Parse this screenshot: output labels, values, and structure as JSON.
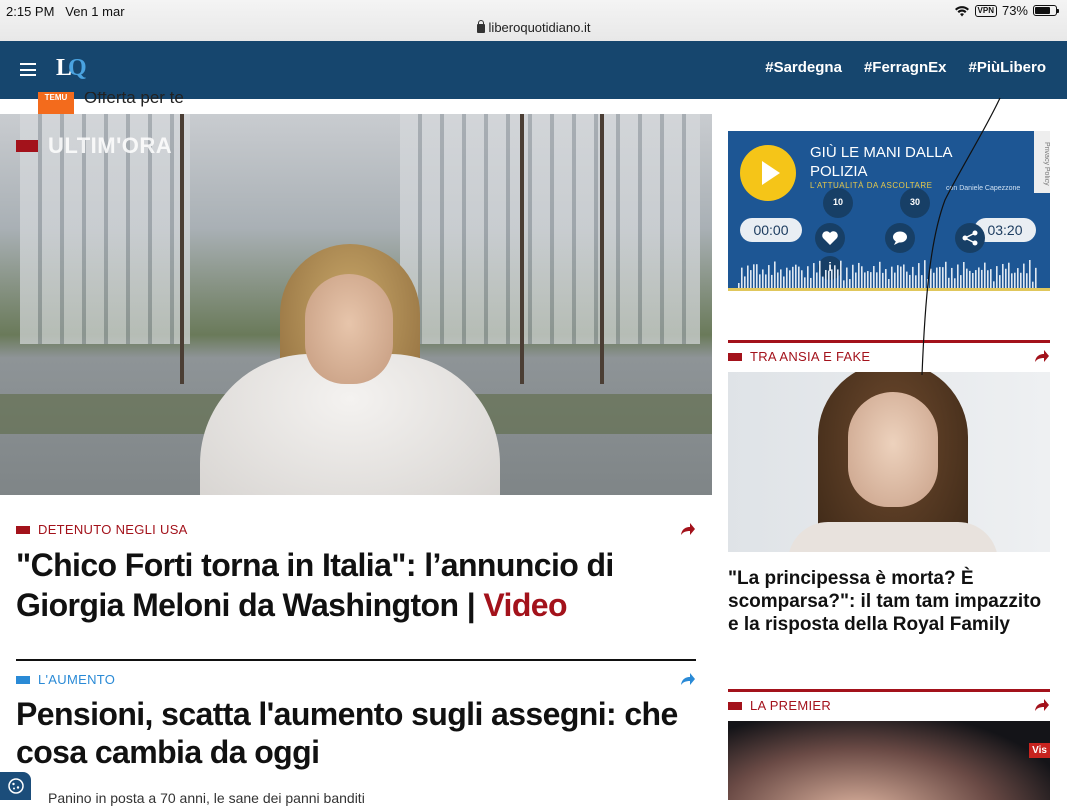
{
  "status": {
    "time": "2:15 PM",
    "date": "Ven 1 mar",
    "url": "liberoquotidiano.it",
    "vpn": "VPN",
    "battery": "73%",
    "battery_level": 0.73
  },
  "header": {
    "logo_text": "LQ",
    "hashtags": [
      "#Sardegna",
      "#FerragnEx",
      "#PiùLibero"
    ]
  },
  "ad": {
    "brand": "TEMU",
    "text": "Offerta per te"
  },
  "hero": {
    "badge": "ULTIM'ORA"
  },
  "articles": [
    {
      "tag": "DETENUTO NEGLI USA",
      "tag_color": "#a3121b",
      "headline": "\"Chico Forti torna in Italia\": l’annuncio di Giorgia Meloni da Washington | ",
      "suffix": "Video"
    },
    {
      "tag": "L'AUMENTO",
      "tag_color": "#2a8ad6",
      "headline": "Pensioni, scatta l'aumento sugli assegni: che cosa cambia da oggi"
    }
  ],
  "subline": "Panino in posta a 70 anni, le sane dei panni banditi",
  "player": {
    "title": "GIÙ LE MANI DALLA POLIZIA",
    "subtitle": "L'ATTUALITÀ DA ASCOLTARE",
    "author": "con Daniele Capezzone",
    "time_start": "00:00",
    "time_end": "03:20",
    "skip_back": "10",
    "skip_fwd": "30",
    "privacy": "Privacy Policy"
  },
  "sidebar": [
    {
      "tag": "TRA ANSIA E FAKE",
      "headline": "\"La principessa è morta? È scomparsa?\": il tam tam impazzito e la risposta della Royal Family"
    },
    {
      "tag": "LA PREMIER",
      "badge": "Vis"
    }
  ],
  "colors": {
    "brand_blue": "#16466e",
    "accent_red": "#a3121b",
    "tag_blue": "#2a8ad6"
  }
}
